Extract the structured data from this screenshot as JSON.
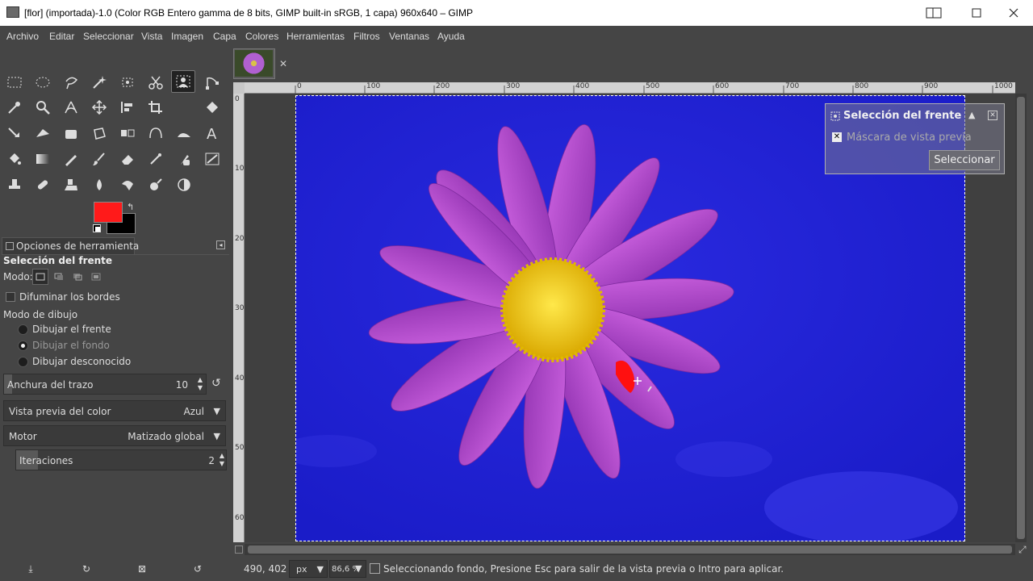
{
  "window": {
    "title": "[flor] (importada)-1.0 (Color RGB Entero gamma de 8 bits, GIMP built-in sRGB, 1 capa) 960x640 – GIMP"
  },
  "menu": [
    "Archivo",
    "Editar",
    "Seleccionar",
    "Vista",
    "Imagen",
    "Capa",
    "Colores",
    "Herramientas",
    "Filtros",
    "Ventanas",
    "Ayuda"
  ],
  "colors": {
    "foreground": "#ff1a1a",
    "background": "#000000",
    "canvas": "#1f20d8",
    "petal": "#b44ad0",
    "center": "#f2d020"
  },
  "tool_options": {
    "tab_label": "Opciones de herramienta",
    "tool_title": "Selección del frente",
    "mode_label": "Modo:",
    "feather_label": "Difuminar los bordes",
    "draw_mode_label": "Modo de dibujo",
    "draw_options": [
      "Dibujar el frente",
      "Dibujar el fondo",
      "Dibujar desconocido"
    ],
    "selected_draw_option": "Dibujar el fondo",
    "stroke_width": {
      "label": "Anchura del trazo",
      "value": "10"
    },
    "color_preview": {
      "label": "Vista previa del color",
      "value": "Azul"
    },
    "engine": {
      "label": "Motor",
      "value": "Matizado global"
    },
    "iterations": {
      "label": "Iteraciones",
      "value": "2"
    }
  },
  "ruler": {
    "h_ticks": [
      "0",
      "100",
      "200",
      "300",
      "400",
      "500",
      "600",
      "700",
      "800",
      "900",
      "1000"
    ],
    "v_ticks": [
      "0",
      "100",
      "200",
      "300",
      "400",
      "500",
      "600"
    ]
  },
  "fg_select_dialog": {
    "title": "Selección del frente",
    "mask_label": "Máscara de vista previa",
    "select_button": "Seleccionar"
  },
  "status": {
    "coords": "490, 402",
    "unit": "px",
    "zoom": "86,6 %",
    "message": "Seleccionando fondo, Presione Esc para salir de la vista previa o Intro para aplicar."
  }
}
